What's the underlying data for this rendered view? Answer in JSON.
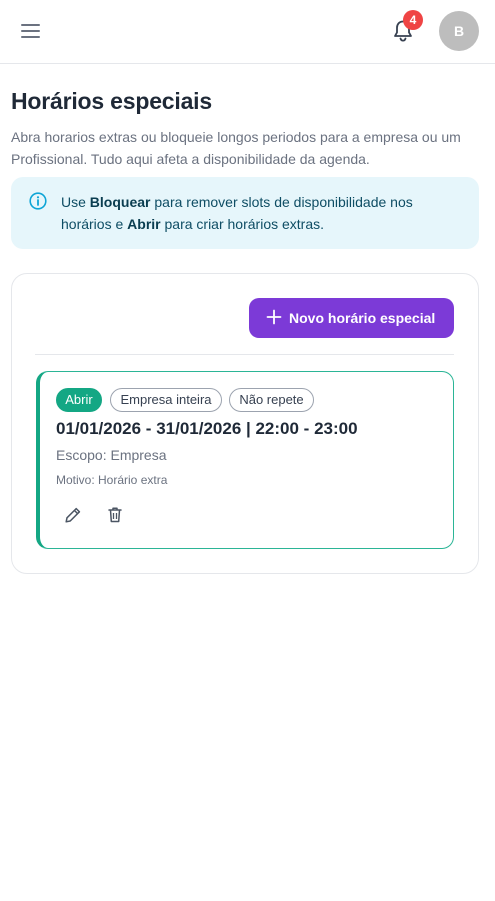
{
  "header": {
    "notification_count": "4",
    "avatar_initial": "B"
  },
  "page": {
    "title": "Horários especiais",
    "description": "Abra horarios extras ou bloqueie longos periodos para a empresa ou um Profissional. Tudo aqui afeta a disponibilidade da agenda."
  },
  "info": {
    "prefix": "Use ",
    "bold_block": "Bloquear",
    "middle": " para remover slots de disponibilidade nos horários e ",
    "bold_open": "Abrir",
    "suffix": " para criar horários extras."
  },
  "actions": {
    "new_label": "Novo horário especial"
  },
  "entries": [
    {
      "type_label": "Abrir",
      "scope_chip": "Empresa inteira",
      "repeat_chip": "Não repete",
      "title": "01/01/2026 - 31/01/2026 | 22:00 - 23:00",
      "scope_line": "Escopo: Empresa",
      "reason_line": "Motivo: Horário extra"
    }
  ],
  "colors": {
    "accent": "#7c3ad7",
    "open_green": "#14a784",
    "info_bg": "#e6f6fb",
    "badge_red": "#ef4444"
  },
  "icons": [
    "menu-icon",
    "bell-icon",
    "info-icon",
    "plus-icon",
    "pencil-icon",
    "trash-icon"
  ]
}
